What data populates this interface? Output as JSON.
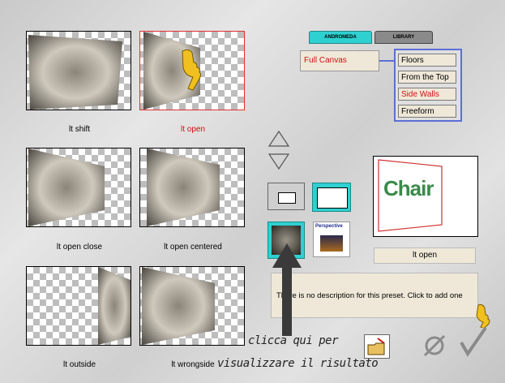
{
  "tabs": {
    "andromeda": "ANDROMEDA",
    "library": "LIBRARY"
  },
  "mode_select": {
    "value": "Full Canvas"
  },
  "options": [
    {
      "label": "Floors",
      "active": false
    },
    {
      "label": "From the Top",
      "active": false
    },
    {
      "label": "Side Walls",
      "active": true
    },
    {
      "label": "Freeform",
      "active": false
    }
  ],
  "presets": [
    {
      "caption": "lt shift"
    },
    {
      "caption": "lt open"
    },
    {
      "caption": "lt open close"
    },
    {
      "caption": "lt open centered"
    },
    {
      "caption": "lt outside"
    },
    {
      "caption": "lt wrongside"
    }
  ],
  "preview_text": "Chair",
  "preview_label": "lt open",
  "small_thumb_label": "Perspective",
  "description": "There is no description for this preset. Click to add one",
  "annotation": {
    "line1": "clicca qui per",
    "line2": "visualizzare il risultato"
  },
  "colors": {
    "accent_red": "#d01010",
    "teal": "#2fd0d0",
    "list_border": "#5b6fd6",
    "chair_green": "#3a8a4a"
  }
}
